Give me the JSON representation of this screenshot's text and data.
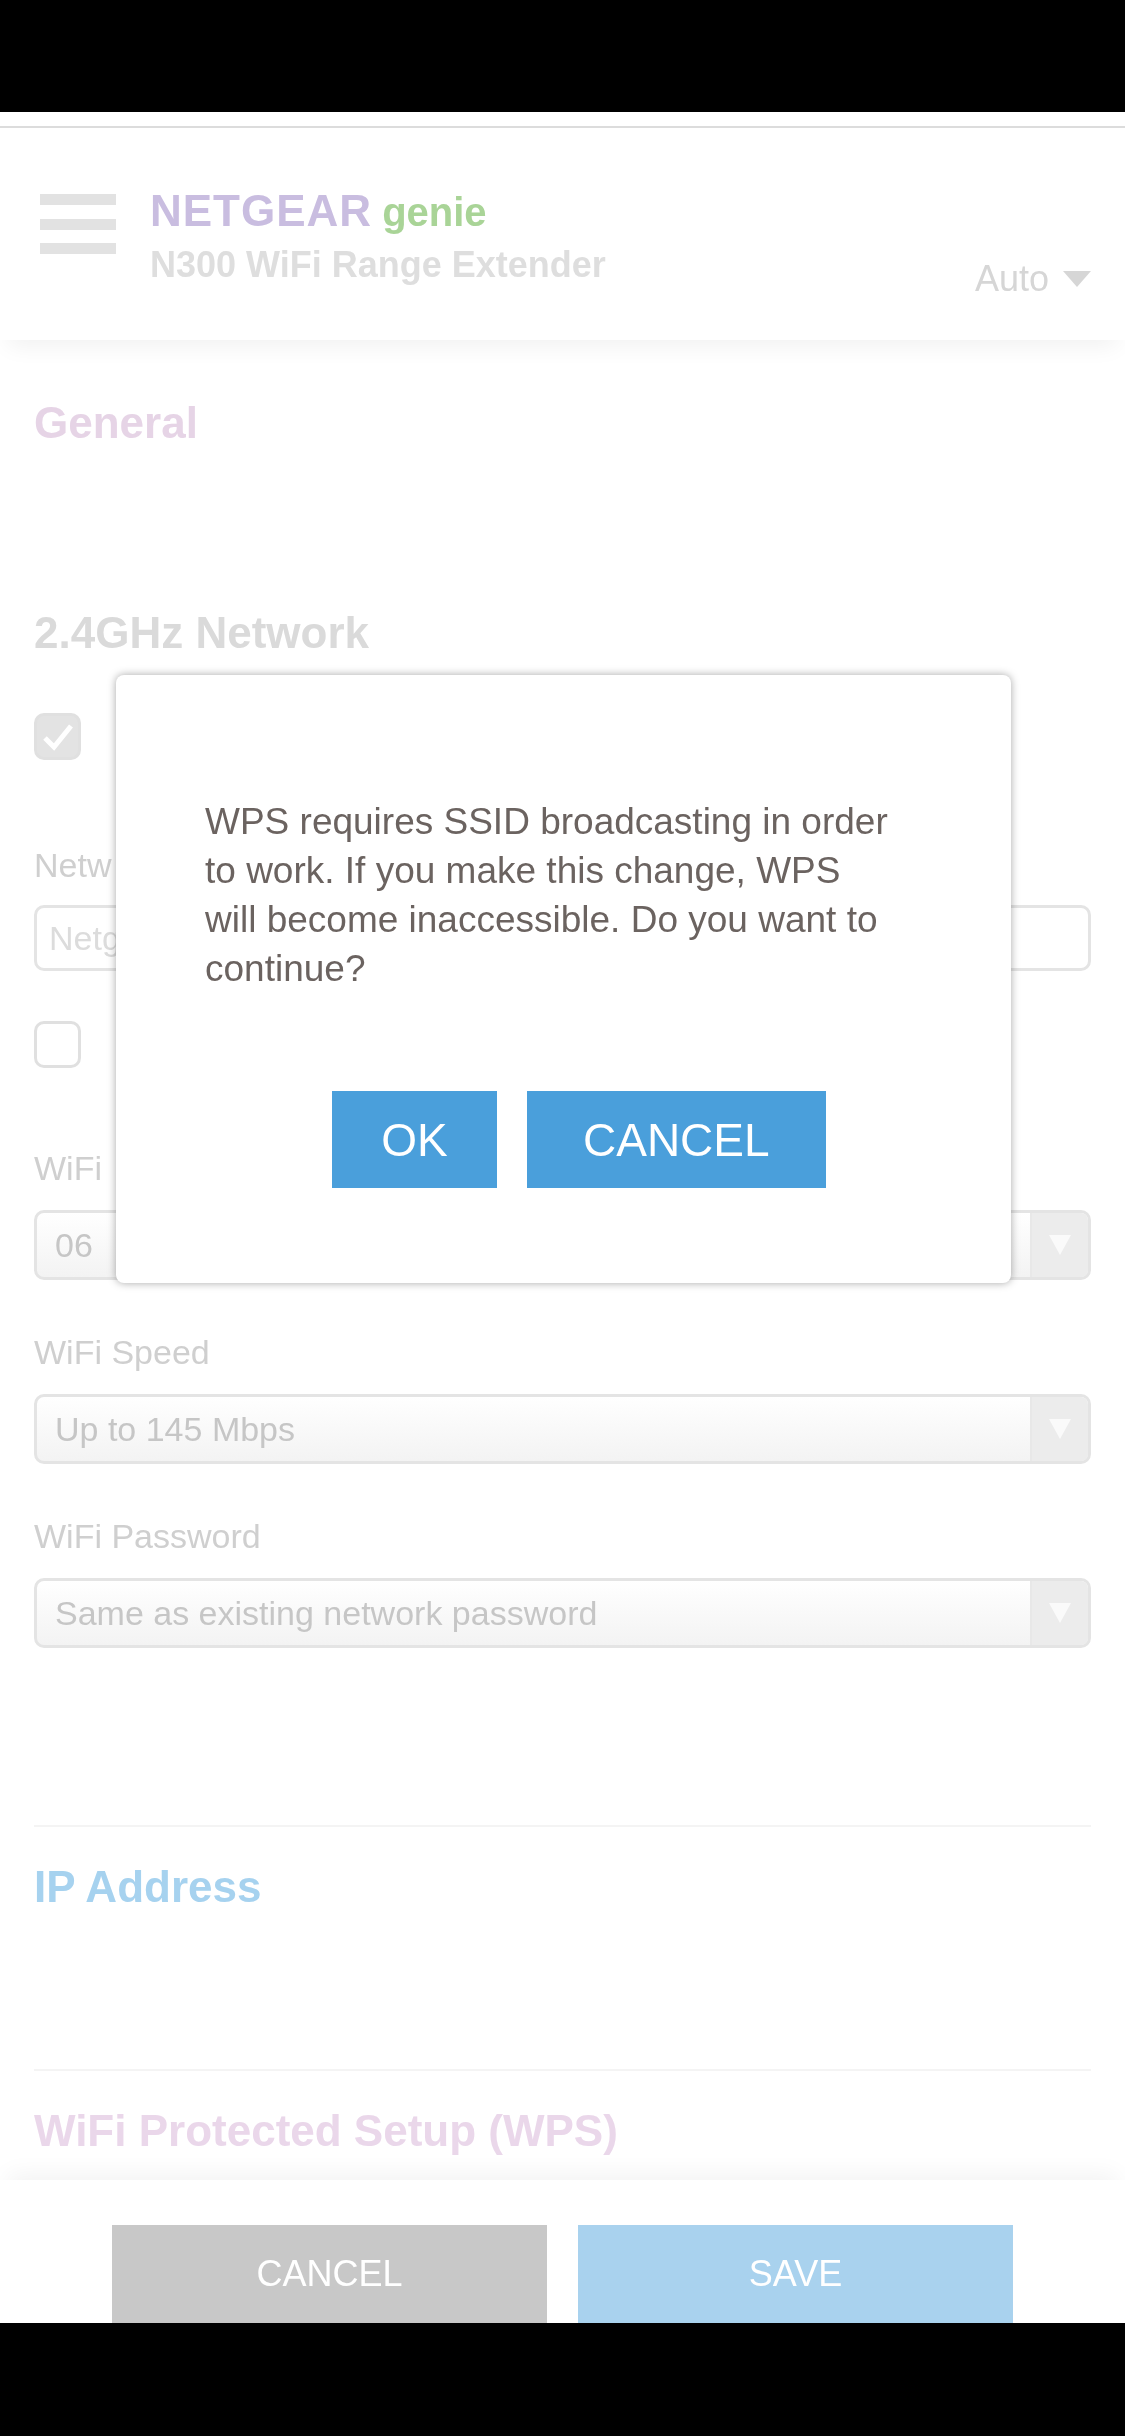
{
  "header": {
    "brand": "NETGEAR",
    "product": "genie",
    "subtitle": "N300 WiFi Range Extender",
    "language": "Auto"
  },
  "general": {
    "title": "General"
  },
  "network": {
    "title": "2.4GHz Network",
    "fields": [
      {
        "kind": "checkbox",
        "checked": true
      },
      {
        "kind": "text",
        "label": "Netw",
        "value": "Netg"
      },
      {
        "kind": "checkbox",
        "checked": false
      },
      {
        "kind": "select",
        "label": "WiFi",
        "value": "06"
      },
      {
        "kind": "select",
        "label": "WiFi Speed",
        "value": "Up to 145 Mbps"
      },
      {
        "kind": "select",
        "label": "WiFi Password",
        "value": "Same as existing network password"
      }
    ]
  },
  "sections": [
    {
      "title": "IP Address",
      "color": "#a6d2ef"
    },
    {
      "title": "WiFi Protected Setup (WPS)",
      "color": "#ead7ea"
    }
  ],
  "footer_buttons": [
    {
      "label": "CANCEL",
      "kind": "secondary"
    },
    {
      "label": "SAVE",
      "kind": "primary"
    }
  ],
  "dialog": {
    "message": "WPS requires SSID broadcasting in order to work. If you make this change, WPS will become inaccessible. Do you want to continue?",
    "buttons": [
      {
        "label": "OK"
      },
      {
        "label": "CANCEL"
      }
    ]
  }
}
